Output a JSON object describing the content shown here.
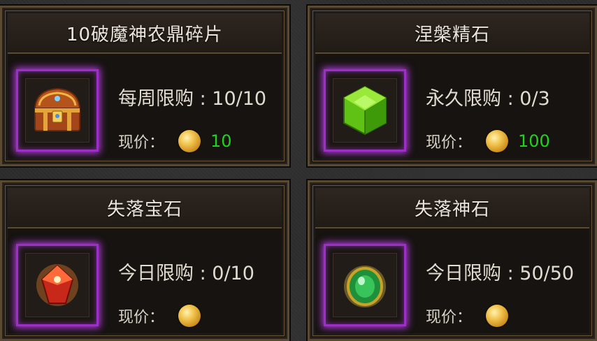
{
  "items": [
    {
      "name": "10破魔神农鼎碎片",
      "limit_label": "每周限购",
      "limit_value": "10/10",
      "price_label": "现价：",
      "price": "10",
      "icon": "treasure-chest-icon"
    },
    {
      "name": "涅槃精石",
      "limit_label": "永久限购",
      "limit_value": "0/3",
      "price_label": "现价：",
      "price": "100",
      "icon": "green-crystal-icon"
    },
    {
      "name": "失落宝石",
      "limit_label": "今日限购",
      "limit_value": "0/10",
      "price_label": "现价：",
      "price": "",
      "icon": "red-gem-icon"
    },
    {
      "name": "失落神石",
      "limit_label": "今日限购",
      "limit_value": "50/50",
      "price_label": "现价：",
      "price": "",
      "icon": "green-orb-icon"
    }
  ],
  "colors": {
    "price_value": "#1fd31f",
    "rarity_glow": "#b43de0"
  }
}
